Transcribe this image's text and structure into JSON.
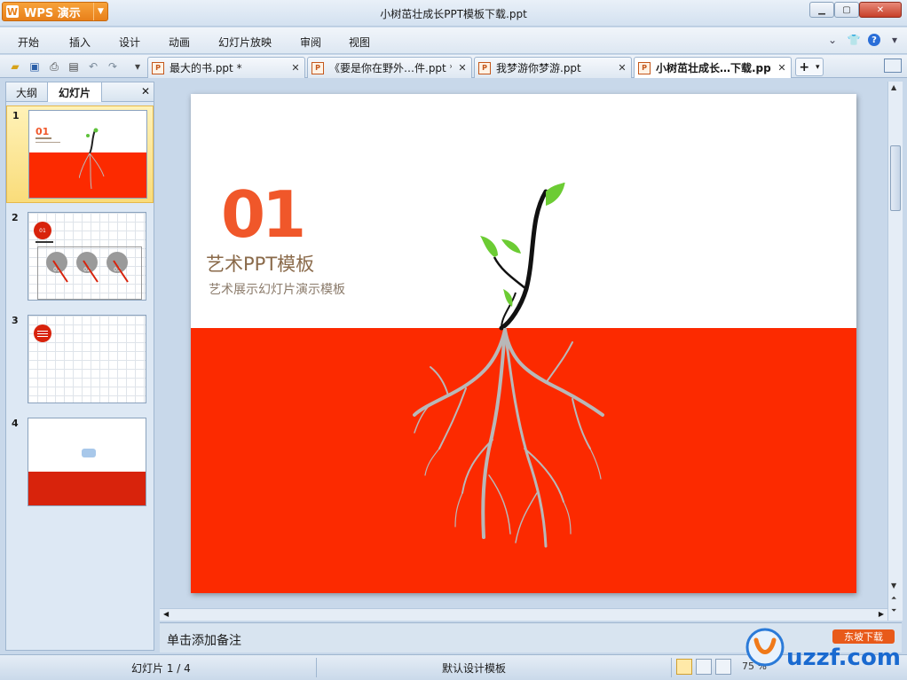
{
  "window": {
    "app_name": "WPS 演示",
    "title": "小树茁壮成长PPT模板下载.ppt",
    "min_glyph": "▁",
    "max_glyph": "▢",
    "close_glyph": "✕"
  },
  "menu": {
    "items": [
      "开始",
      "插入",
      "设计",
      "动画",
      "幻灯片放映",
      "审阅",
      "视图"
    ]
  },
  "tabs": [
    {
      "label": "最大的书.ppt *"
    },
    {
      "label": "《要是你在野外…件.ppt *"
    },
    {
      "label": "我梦游你梦游.ppt"
    },
    {
      "label": "小树茁壮成长…下载.ppt"
    }
  ],
  "left_pane": {
    "tab_outline": "大纲",
    "tab_slides": "幻灯片",
    "slide_numbers": [
      "1",
      "2",
      "3",
      "4"
    ],
    "thumb1_num": "01",
    "thumb2_tag": "01",
    "thumb2_labels": [
      "01",
      "02",
      "03"
    ]
  },
  "slide": {
    "number": "01",
    "title": "艺术PPT模板",
    "subtitle": "艺术展示幻灯片演示模板"
  },
  "notes": {
    "placeholder": "单击添加备注"
  },
  "status": {
    "slide_indicator": "幻灯片 1 / 4",
    "template": "默认设计模板",
    "zoom": "75 %"
  },
  "watermark": {
    "site": "uzzf.com",
    "tag": "东坡下载"
  },
  "colors": {
    "slide_red": "#fc2a00",
    "number_orange": "#f0572a",
    "app_orange": "#e8801a"
  }
}
